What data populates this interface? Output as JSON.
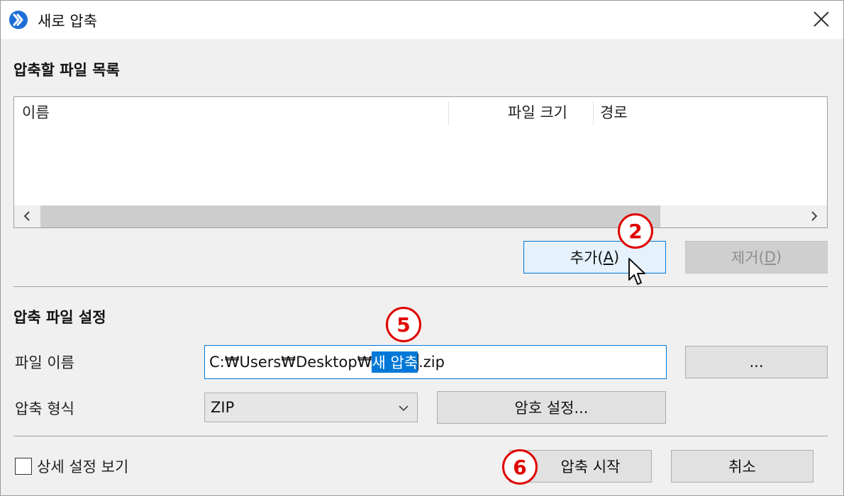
{
  "window": {
    "title": "새로 압축",
    "icon": "app-arrow-icon",
    "close_icon": "close-icon"
  },
  "file_list": {
    "section_title": "압축할 파일 목록",
    "columns": [
      {
        "label": "이름"
      },
      {
        "label": "파일 크기"
      },
      {
        "label": "경로"
      }
    ],
    "rows": [],
    "add_button": {
      "label_prefix": "추가(",
      "mnemonic": "A",
      "label_suffix": ")"
    },
    "remove_button": {
      "label_prefix": "제거(",
      "mnemonic": "D",
      "label_suffix": ")",
      "disabled": true
    }
  },
  "archive_settings": {
    "section_title": "압축 파일 설정",
    "file_name": {
      "label": "파일 이름",
      "value_prefix": "C:₩Users₩Desktop₩",
      "value_selected": "새 압축",
      "value_suffix": ".zip",
      "browse_label": "..."
    },
    "format": {
      "label": "압축 형식",
      "selected": "ZIP",
      "password_button_label": "암호 설정..."
    }
  },
  "footer": {
    "details_checkbox": {
      "label": "상세 설정 보기",
      "checked": false
    },
    "start_button_label": "압축 시작",
    "cancel_button_label": "취소"
  },
  "annotations": {
    "step_add": "2",
    "step_filename": "5",
    "step_start": "6",
    "color": "#e00000"
  },
  "colors": {
    "accent": "#0078d7",
    "window_bg": "#f0f0f0",
    "button_bg": "#e1e1e1"
  }
}
